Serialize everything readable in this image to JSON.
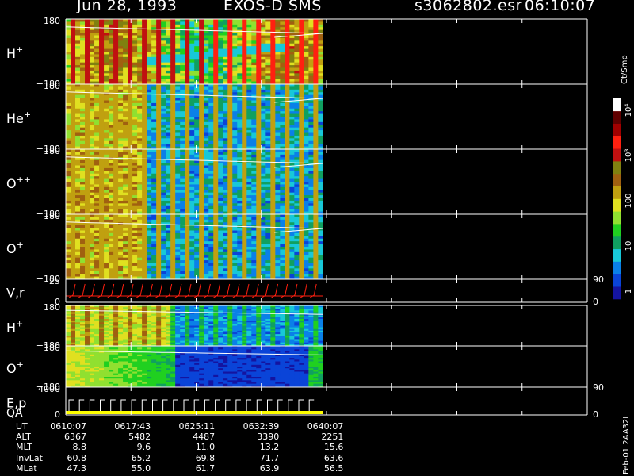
{
  "header": {
    "date": "Jun 28, 1993",
    "instrument": "EXOS-D SMS",
    "filename": "s3062802.esr",
    "time": "06:10:07"
  },
  "colors": {
    "background": "#000000",
    "foreground": "#ffffff",
    "trace_red": "#ff2010",
    "trace_white": "#ffffff",
    "trace_yellow": "#ffff00"
  },
  "colorbar": {
    "unit_label": "Ct/Smp",
    "tick_labels": [
      "1",
      "10",
      "100",
      "10³",
      "10⁴"
    ],
    "colors": [
      "#1414a0",
      "#0a44d8",
      "#0a80e8",
      "#18c8d8",
      "#10a060",
      "#20d020",
      "#90e030",
      "#e0e020",
      "#c0a010",
      "#a06010",
      "#808010",
      "#c01010",
      "#ff2010",
      "#a00000",
      "#600000",
      "#ffffff"
    ]
  },
  "panels": [
    {
      "id": "h-plus",
      "species": "H",
      "charge": "+",
      "ymax": "180",
      "ymin": "−180"
    },
    {
      "id": "he-plus",
      "species": "He",
      "charge": "+",
      "ymax": "180",
      "ymin": "−180"
    },
    {
      "id": "o-pp",
      "species": "O",
      "charge": "++",
      "ymax": "180",
      "ymin": "−180"
    },
    {
      "id": "o-plus",
      "species": "O",
      "charge": "+",
      "ymax": "180",
      "ymin": "−180"
    },
    {
      "id": "vr",
      "species": "V,r",
      "charge": "",
      "ymax": "25",
      "ymin": "0",
      "right_max": "90",
      "right_min": "0"
    },
    {
      "id": "h-plus-2",
      "species": "H",
      "charge": "+",
      "ymax": "180",
      "ymin": "−180"
    },
    {
      "id": "o-plus-2",
      "species": "O",
      "charge": "+",
      "ymax": "180",
      "ymin": "−180"
    },
    {
      "id": "ep",
      "species": "E,p",
      "charge": "",
      "ymax": "4000",
      "ymin": "0",
      "right_max": "90",
      "right_min": "0"
    }
  ],
  "qa_label": "QA",
  "chart_data": {
    "type": "heatmap",
    "title": "Jun 28, 1993   EXOS-D SMS",
    "x_axis": {
      "ticks_ut": [
        "0610:07",
        "0617:43",
        "0625:11",
        "0632:39",
        "0640:07"
      ],
      "data_fraction_of_axis": 0.493
    },
    "ephemeris": {
      "rows": [
        {
          "label": "UT",
          "values": [
            "0610:07",
            "0617:43",
            "0625:11",
            "0632:39",
            "0640:07"
          ]
        },
        {
          "label": "ALT",
          "values": [
            "6367",
            "5482",
            "4487",
            "3390",
            "2251"
          ]
        },
        {
          "label": "MLT",
          "values": [
            "8.8",
            "9.6",
            "11.0",
            "13.2",
            "15.6"
          ]
        },
        {
          "label": "InvLat",
          "values": [
            "60.8",
            "65.2",
            "69.8",
            "71.7",
            "63.6"
          ]
        },
        {
          "label": "MLat",
          "values": [
            "47.3",
            "55.0",
            "61.7",
            "63.9",
            "56.5"
          ]
        }
      ]
    },
    "pitch_angle_range": [
      -180,
      180
    ],
    "colorbar_range": [
      1,
      10000
    ],
    "colorbar_scale": "log"
  },
  "footer_stamp": "Feb-01 2AA32L"
}
